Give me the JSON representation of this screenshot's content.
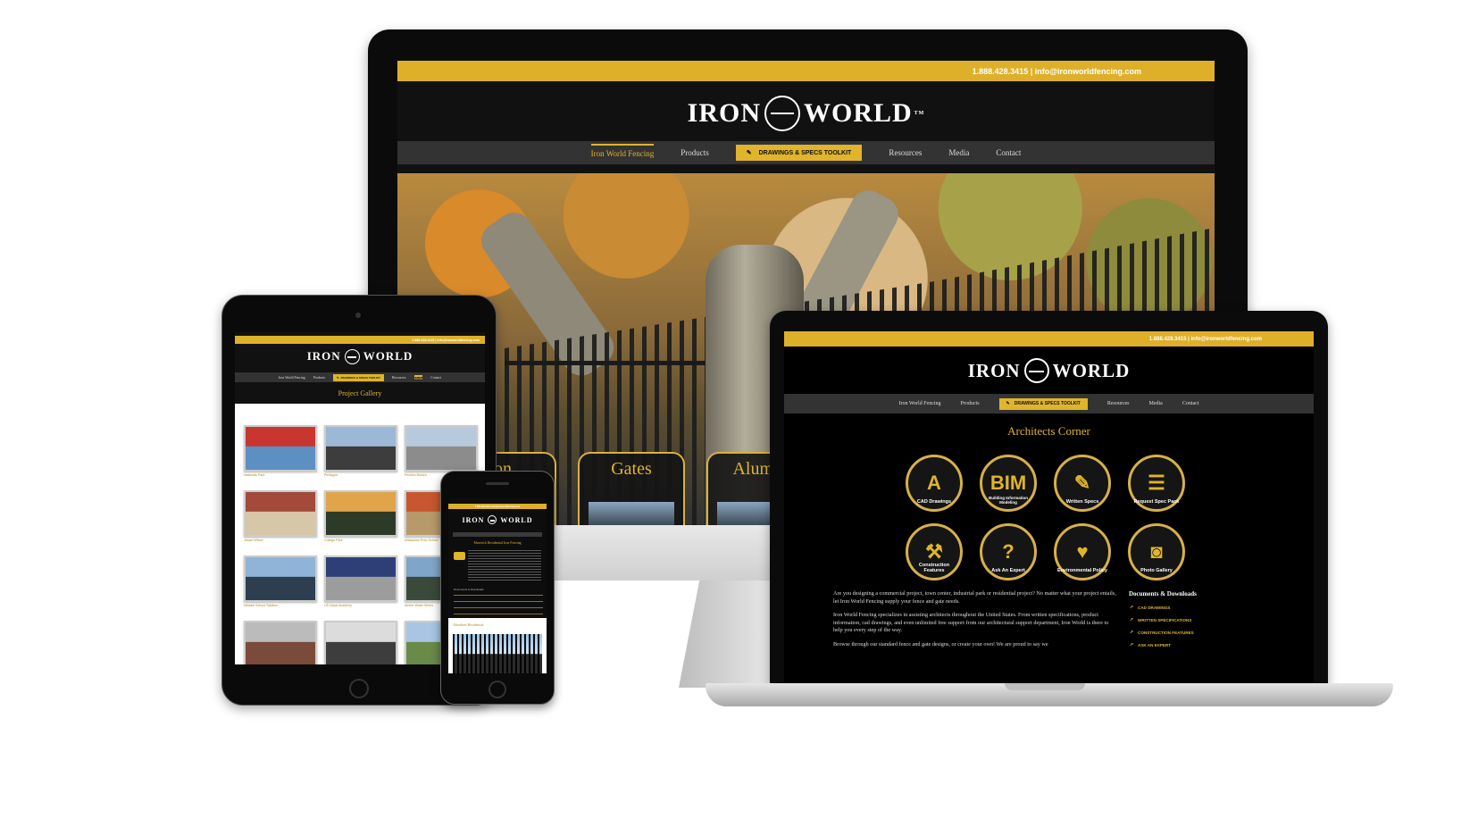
{
  "site": {
    "contact_line": "1.888.428.3415 | info@ironworldfencing.com",
    "logo_left": "IRON",
    "logo_right": "WORLD",
    "logo_tm": "TM",
    "nav": {
      "home": "Iron World Fencing",
      "products": "Products",
      "toolkit": "DRAWINGS & SPECS TOOLKIT",
      "resources": "Resources",
      "media": "Media",
      "contact": "Contact"
    },
    "hero_tabs": [
      "on",
      "Gates",
      "Alumin"
    ]
  },
  "laptop": {
    "page_title": "Architects Corner",
    "icons": [
      {
        "label": "CAD Drawings",
        "icon": "cad-icon",
        "glyph": "A"
      },
      {
        "label": "Building Information Modeling",
        "icon": "bim-icon",
        "glyph": "BIM"
      },
      {
        "label": "Written Specs",
        "icon": "document-pen-icon",
        "glyph": "✎"
      },
      {
        "label": "Request Spec Pack",
        "icon": "spec-pack-icon",
        "glyph": "☰"
      },
      {
        "label": "Construction Features",
        "icon": "hammer-wrench-icon",
        "glyph": "⚒"
      },
      {
        "label": "Ask An Expert",
        "icon": "expert-icon",
        "glyph": "?"
      },
      {
        "label": "Environmental Policy",
        "icon": "globe-heart-icon",
        "glyph": "♥"
      },
      {
        "label": "Photo Gallery",
        "icon": "camera-icon",
        "glyph": "◙"
      }
    ],
    "paragraphs": [
      "Are you designing a commercial project, town center, industrial park or residential project? No matter what your project entails, let Iron World Fencing supply your fence and gate needs.",
      "Iron World Fencing specializes in assisting architects throughout the United States. From written specifications, product information, cad drawings, and even unlimited free support from our architectural support department, Iron World is there to help you every step of the way.",
      "Browse through our standard fence and gate designs, or create your own! We are proud to say we"
    ],
    "sidebar_title": "Documents & Downloads",
    "sidebar_links": [
      "CAD DRAWINGS",
      "WRITTEN SPECIFICATIONS",
      "CONSTRUCTION FEATURES",
      "ASK AN EXPERT"
    ]
  },
  "tablet": {
    "page_title": "Project Gallery",
    "gallery": [
      {
        "caption": "Nationals Park",
        "colors": [
          "#c7372f",
          "#5c8fc2"
        ]
      },
      {
        "caption": "Pentagon",
        "colors": [
          "#9cb8d6",
          "#3d3d3d"
        ]
      },
      {
        "caption": "Pavilion Boston",
        "colors": [
          "#b7c9dc",
          "#8c8c8c"
        ]
      },
      {
        "caption": "Jessie Willow",
        "colors": [
          "#a34a3a",
          "#d6c7a8"
        ]
      },
      {
        "caption": "College Park",
        "colors": [
          "#e0a44a",
          "#2d3a28"
        ]
      },
      {
        "caption": "Milwaukee Prep School",
        "colors": [
          "#c7572f",
          "#b89a6a"
        ]
      },
      {
        "caption": "Newark School Stadium",
        "colors": [
          "#8fb4d8",
          "#2c3e50"
        ]
      },
      {
        "caption": "US Naval Academy",
        "colors": [
          "#2e3f78",
          "#9c9c9c"
        ]
      },
      {
        "caption": "Amber Water Works",
        "colors": [
          "#7fa6c9",
          "#3a4a3a"
        ]
      },
      {
        "caption": "",
        "colors": [
          "#bbbbbb",
          "#7a4a3a"
        ]
      },
      {
        "caption": "",
        "colors": [
          "#dcdcdc",
          "#3d3d3d"
        ]
      },
      {
        "caption": "",
        "colors": [
          "#a8c6e4",
          "#6a8a4a"
        ]
      }
    ]
  },
  "phone": {
    "page_title": "Maverick Residential Iron Fencing",
    "downloads_label": "Documents & Downloads",
    "section_title": "Aberdeen Residential"
  }
}
